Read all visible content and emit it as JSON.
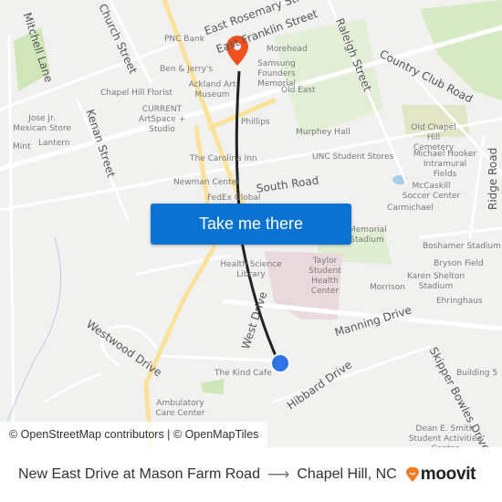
{
  "map": {
    "button_label": "Take me there",
    "attribution": "© OpenStreetMap contributors | © OpenMapTiles",
    "colors": {
      "background": "#f1f1f0",
      "road": "#ffffff",
      "major_road": "#fbe29c",
      "park": "#cfe6b8",
      "hospital": "#e8d5d8",
      "water": "#a9cdf0",
      "route": "#222222",
      "destination_pin": "#f0501e",
      "origin_dot": "#2f74e6",
      "button": "#0a73d1"
    },
    "streets": [
      "East Rosemary Street",
      "East Franklin Street",
      "Raleigh Street",
      "Country Club Road",
      "Church Street",
      "Mitchell Lane",
      "Kenan Street",
      "South Road",
      "West Drive",
      "Manning Drive",
      "Hibbard Drive",
      "Westwood Drive",
      "Skipper Bowles Drive",
      "Ridge Road"
    ],
    "places": [
      "PNC Bank",
      "Ben & Jerry's",
      "Ackland Art Museum",
      "Chapel Hill Florist",
      "CURRENT ArtSpace + Studio",
      "Jose Jr. Mexican Store",
      "Mint",
      "Lantern",
      "Morehead",
      "Samsung Founders Memorial",
      "Old East",
      "Phillips",
      "Murphey Hall",
      "The Carolina Inn",
      "UNC Student Stores",
      "Old Chapel Hill Cemetery",
      "Michael Hooker Intramural Fields",
      "Newman Center",
      "FedEx Global",
      "McCaskill Soccer Center",
      "Carmichael",
      "Memorial Stadium",
      "Boshamer Stadium",
      "Bryson Field",
      "Health Science Library",
      "Taylor Student Health Center",
      "Karen Shelton Stadium",
      "Morrison",
      "Ehringhaus",
      "The Kind Cafe",
      "Building 5",
      "Ambulatory Care Center",
      "Dean E. Smith Student Activities Center"
    ]
  },
  "footer": {
    "origin": "New East Drive at Mason Farm Road",
    "arrow": "⟶",
    "destination": "Chapel Hill, NC",
    "brand": "moovit",
    "brand_color": "#f47b20"
  }
}
